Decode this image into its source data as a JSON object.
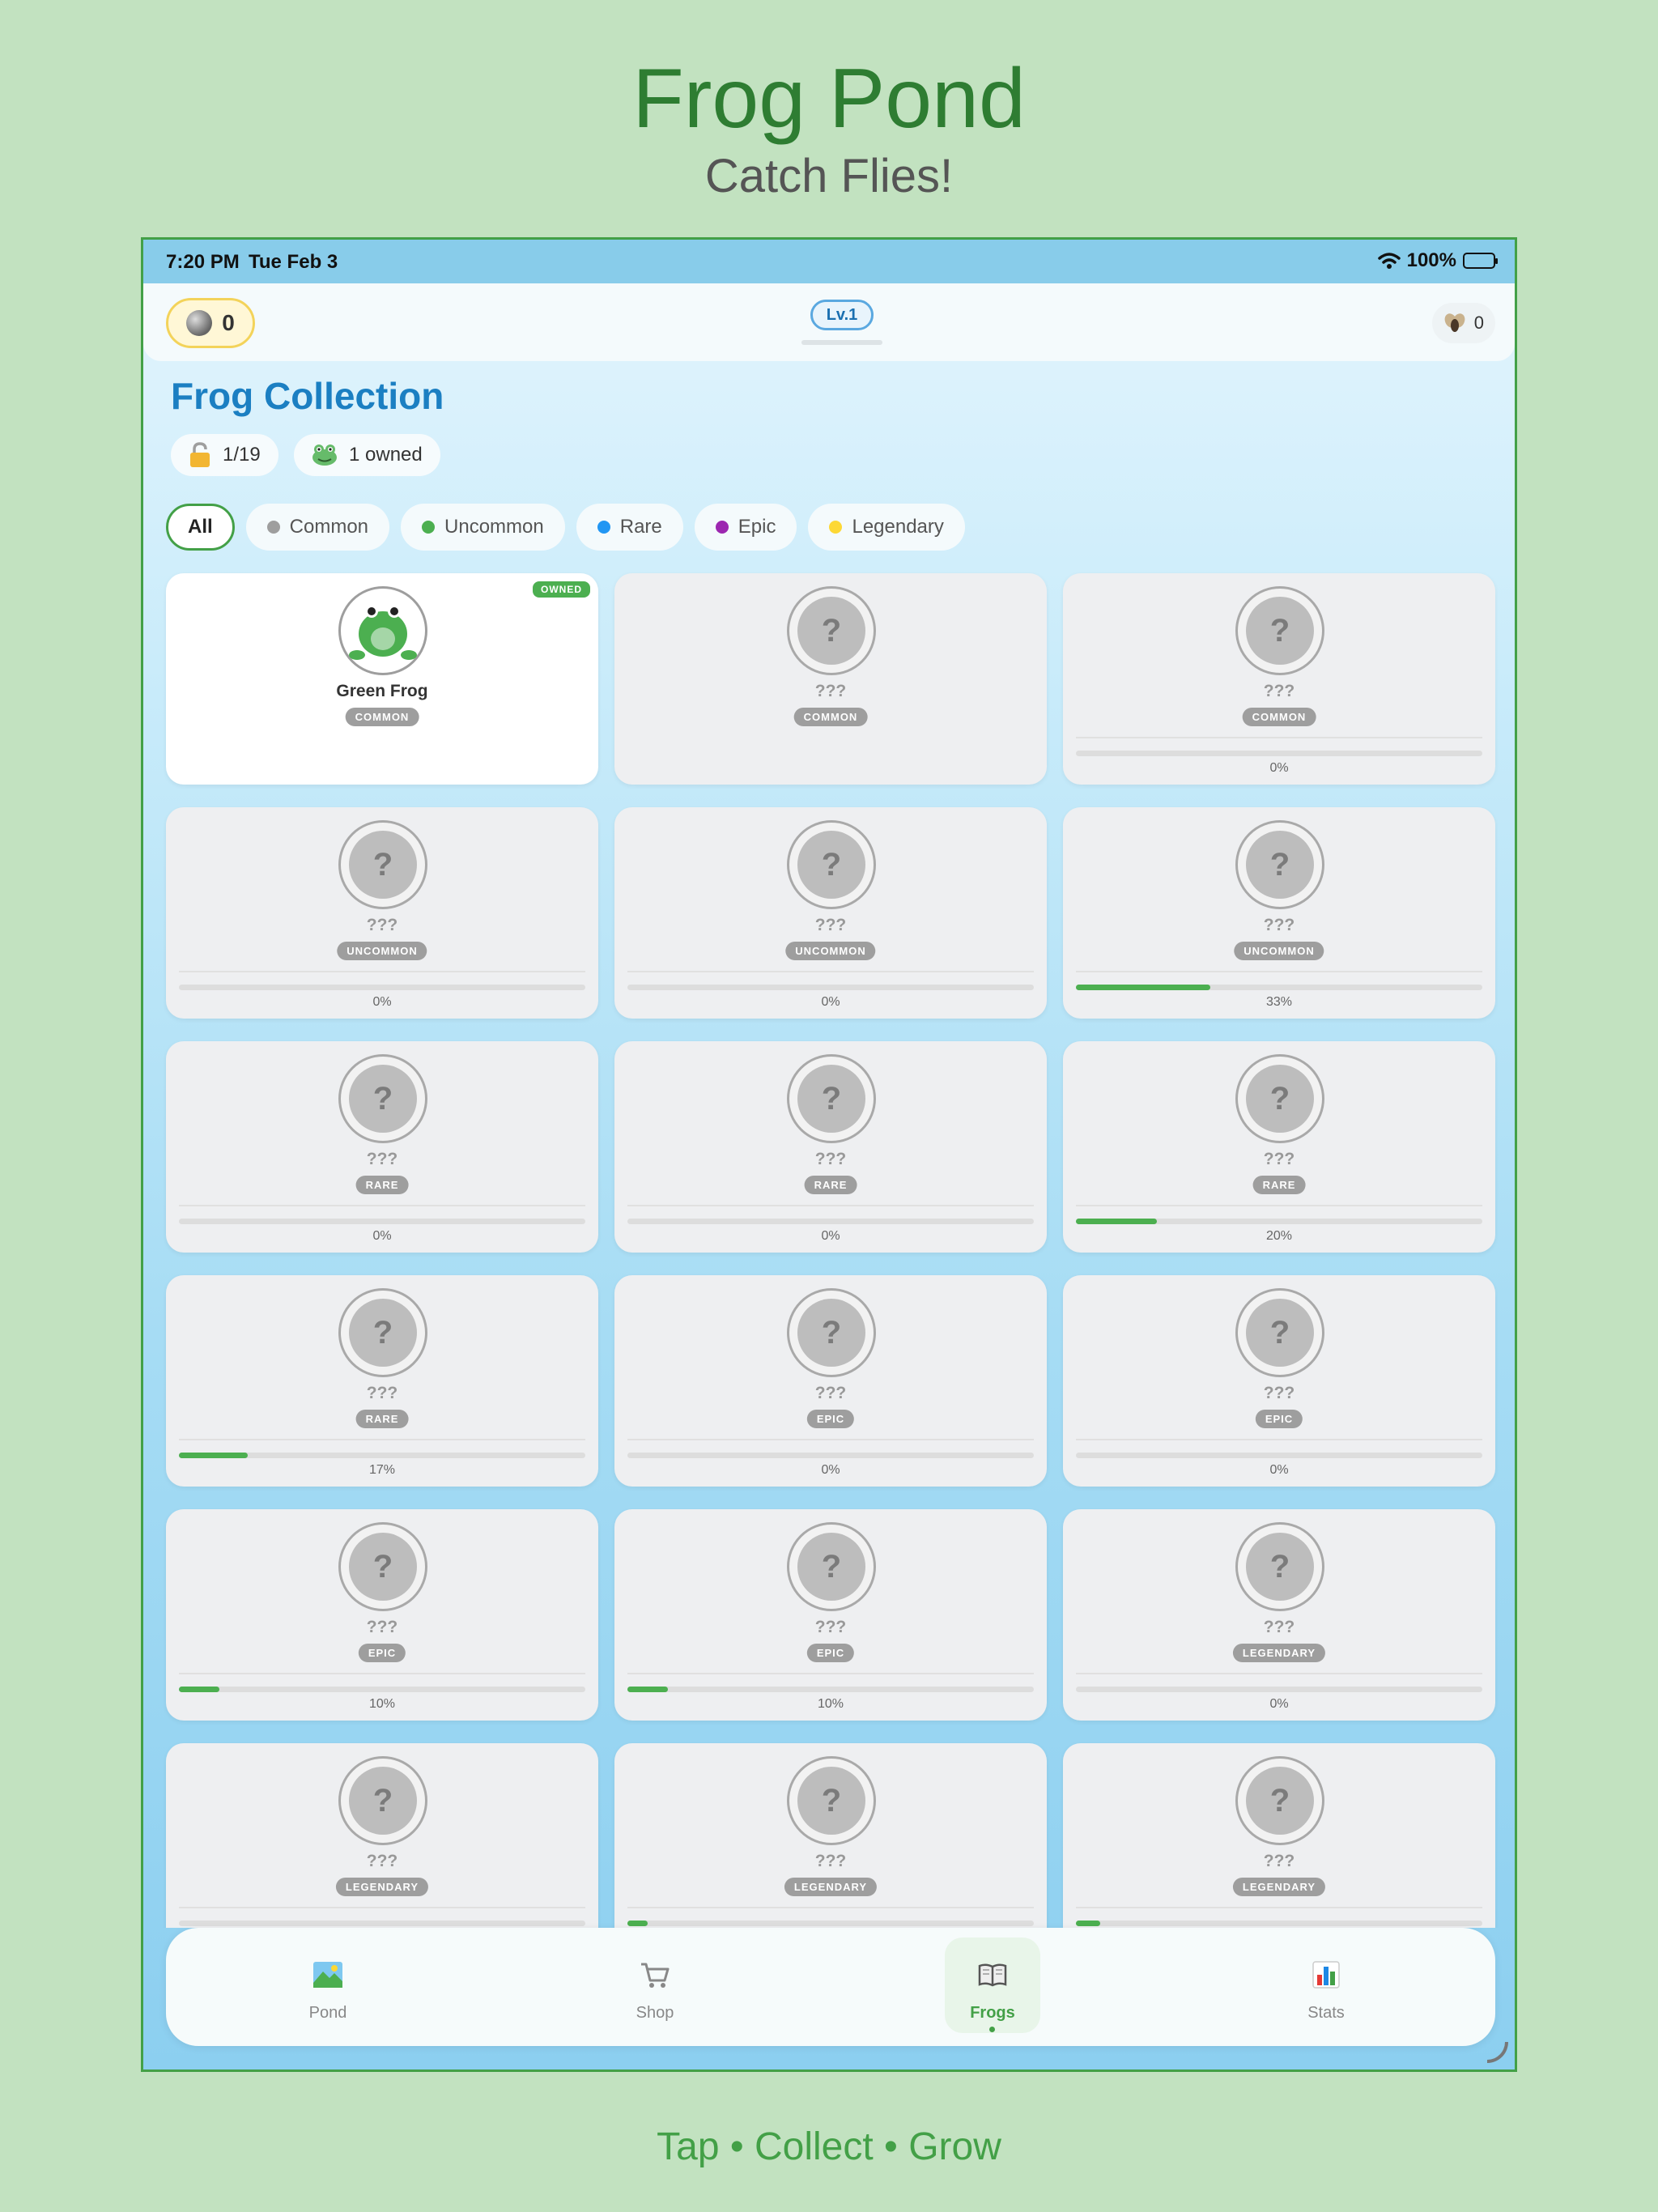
{
  "hero": {
    "title": "Frog Pond",
    "subtitle": "Catch Flies!",
    "tagline": "Tap • Collect • Grow"
  },
  "status_bar": {
    "time": "7:20 PM",
    "date": "Tue Feb 3",
    "battery": "100%"
  },
  "top_bar": {
    "coins": "0",
    "level": "Lv.1",
    "flies": "0"
  },
  "collection": {
    "title": "Frog Collection",
    "unlocked": "1/19",
    "owned": "1 owned"
  },
  "filters": [
    {
      "label": "All",
      "active": true,
      "color": ""
    },
    {
      "label": "Common",
      "active": false,
      "color": "#9e9e9e"
    },
    {
      "label": "Uncommon",
      "active": false,
      "color": "#4caf50"
    },
    {
      "label": "Rare",
      "active": false,
      "color": "#2196f3"
    },
    {
      "label": "Epic",
      "active": false,
      "color": "#9c27b0"
    },
    {
      "label": "Legendary",
      "active": false,
      "color": "#fdd835"
    }
  ],
  "cards": [
    {
      "name": "Green Frog",
      "rarity": "COMMON",
      "owned": true,
      "owned_label": "OWNED",
      "progress": null
    },
    {
      "name": "???",
      "rarity": "COMMON",
      "owned": false,
      "progress": null
    },
    {
      "name": "???",
      "rarity": "COMMON",
      "owned": false,
      "progress": 0,
      "progress_label": "0%"
    },
    {
      "name": "???",
      "rarity": "UNCOMMON",
      "owned": false,
      "progress": 0,
      "progress_label": "0%"
    },
    {
      "name": "???",
      "rarity": "UNCOMMON",
      "owned": false,
      "progress": 0,
      "progress_label": "0%"
    },
    {
      "name": "???",
      "rarity": "UNCOMMON",
      "owned": false,
      "progress": 33,
      "progress_label": "33%"
    },
    {
      "name": "???",
      "rarity": "RARE",
      "owned": false,
      "progress": 0,
      "progress_label": "0%"
    },
    {
      "name": "???",
      "rarity": "RARE",
      "owned": false,
      "progress": 0,
      "progress_label": "0%"
    },
    {
      "name": "???",
      "rarity": "RARE",
      "owned": false,
      "progress": 20,
      "progress_label": "20%"
    },
    {
      "name": "???",
      "rarity": "RARE",
      "owned": false,
      "progress": 17,
      "progress_label": "17%"
    },
    {
      "name": "???",
      "rarity": "EPIC",
      "owned": false,
      "progress": 0,
      "progress_label": "0%"
    },
    {
      "name": "???",
      "rarity": "EPIC",
      "owned": false,
      "progress": 0,
      "progress_label": "0%"
    },
    {
      "name": "???",
      "rarity": "EPIC",
      "owned": false,
      "progress": 10,
      "progress_label": "10%"
    },
    {
      "name": "???",
      "rarity": "EPIC",
      "owned": false,
      "progress": 10,
      "progress_label": "10%"
    },
    {
      "name": "???",
      "rarity": "LEGENDARY",
      "owned": false,
      "progress": 0,
      "progress_label": "0%"
    },
    {
      "name": "???",
      "rarity": "LEGENDARY",
      "owned": false,
      "progress": 0,
      "progress_label": ""
    },
    {
      "name": "???",
      "rarity": "LEGENDARY",
      "owned": false,
      "progress": 5,
      "progress_label": ""
    },
    {
      "name": "???",
      "rarity": "LEGENDARY",
      "owned": false,
      "progress": 6,
      "progress_label": ""
    }
  ],
  "nav": [
    {
      "label": "Pond",
      "icon": "landscape-icon",
      "active": false
    },
    {
      "label": "Shop",
      "icon": "cart-icon",
      "active": false
    },
    {
      "label": "Frogs",
      "icon": "book-icon",
      "active": true
    },
    {
      "label": "Stats",
      "icon": "chart-icon",
      "active": false
    }
  ],
  "colors": {
    "accent": "#43a047",
    "title_blue": "#1b7fc2",
    "badge_gray": "#9e9e9e"
  }
}
